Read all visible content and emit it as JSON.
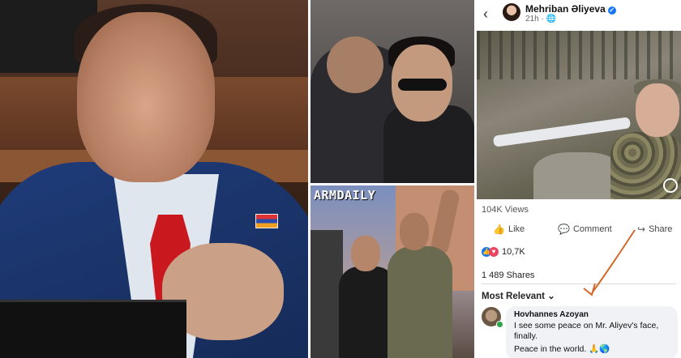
{
  "watermark": "ARMDAILY",
  "post": {
    "author": "Mehriban Əliyeva",
    "time": "21h",
    "time_icon": "globe-icon",
    "views": "104K Views",
    "actions": {
      "like": "Like",
      "comment": "Comment",
      "share": "Share"
    },
    "reactions_count": "10,7K",
    "shares": "1 489 Shares",
    "sort_label": "Most Relevant"
  },
  "comment": {
    "author": "Hovhannes Azoyan",
    "text": "I see some peace on Mr. Aliyev's face, finally.",
    "text2": "Peace in the world. 🙏🌎"
  },
  "colors": {
    "facebook_blue": "#1877f2",
    "annotation_arrow": "#d2692a",
    "tie_red": "#c9191f"
  }
}
